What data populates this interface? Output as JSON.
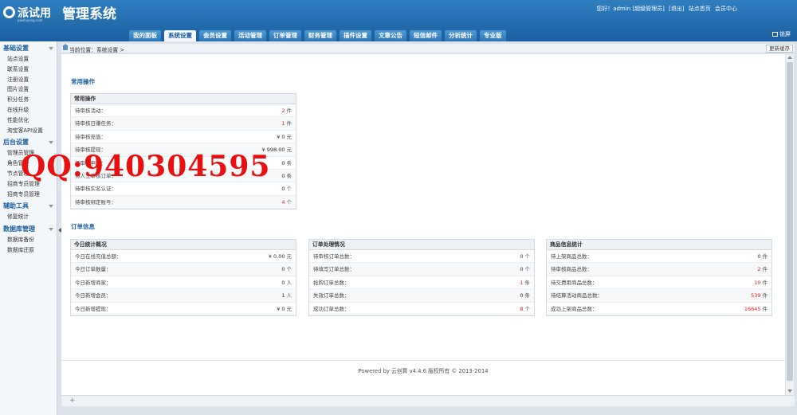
{
  "header": {
    "logo_text": "派试用",
    "logo_sub": "paishiyong.com",
    "title": "管理系统",
    "links": [
      "您好！admin [超级管理员]",
      "[退出]",
      "站点首页",
      "会员中心"
    ],
    "lock_label": "锁屏",
    "nav_tabs": [
      {
        "label": "我的面板",
        "active": false
      },
      {
        "label": "系统设置",
        "active": true
      },
      {
        "label": "会员设置",
        "active": false
      },
      {
        "label": "活动管理",
        "active": false
      },
      {
        "label": "订单管理",
        "active": false
      },
      {
        "label": "财务管理",
        "active": false
      },
      {
        "label": "插件设置",
        "active": false
      },
      {
        "label": "文章公告",
        "active": false
      },
      {
        "label": "短信邮件",
        "active": false
      },
      {
        "label": "分析统计",
        "active": false
      },
      {
        "label": "专业版",
        "active": false
      }
    ]
  },
  "sidebar": {
    "groups": [
      {
        "title": "基础设置",
        "items": [
          "站点设置",
          "联系设置",
          "注册设置",
          "图片设置",
          "积分任务",
          "在线升级",
          "性能优化",
          "淘宝客API设置"
        ]
      },
      {
        "title": "后台设置",
        "items": [
          "管理员管理",
          "角色管理",
          "节点管理",
          "招商专员管理",
          "招商专员管理"
        ]
      },
      {
        "title": "辅助工具",
        "items": [
          "修复统计"
        ]
      },
      {
        "title": "数据库管理",
        "items": [
          "数据库备份",
          "数据库还原"
        ]
      }
    ]
  },
  "breadcrumb": "当前位置：系统设置 >",
  "refresh_label": "更新缓存",
  "common": {
    "section_title": "常用操作",
    "table_title": "常用操作",
    "rows": [
      {
        "label": "待审核活动：",
        "value": "2",
        "unit": "件",
        "red": true
      },
      {
        "label": "待审核日赚任务：",
        "value": "1",
        "unit": "件",
        "red": true
      },
      {
        "label": "待审核充值：",
        "value": "¥ 0",
        "unit": "元",
        "red": false
      },
      {
        "label": "待审核提现：",
        "value": "¥ 998.00",
        "unit": "元",
        "red": false
      },
      {
        "label": "待审核申诉：",
        "value": "0",
        "unit": "条",
        "red": false
      },
      {
        "label": "待人工审核订单：",
        "value": "0",
        "unit": "条",
        "red": false
      },
      {
        "label": "待审核实名认证：",
        "value": "0",
        "unit": "个",
        "red": false
      },
      {
        "label": "待审核绑定账号：",
        "value": "4",
        "unit": "个",
        "red": true
      }
    ]
  },
  "orders": {
    "section_title": "订单信息",
    "today": {
      "title": "今日统计概况",
      "rows": [
        {
          "label": "今日在线充值总额：",
          "value": "¥ 0.00",
          "unit": "元",
          "red": false
        },
        {
          "label": "今日订单数量：",
          "value": "0",
          "unit": "个",
          "red": false
        },
        {
          "label": "今日新增商家：",
          "value": "0",
          "unit": "人",
          "red": false
        },
        {
          "label": "今日新增会员：",
          "value": "1",
          "unit": "人",
          "red": false
        },
        {
          "label": "今日新增提现：",
          "value": "¥ 0",
          "unit": "元",
          "red": false
        }
      ]
    },
    "processing": {
      "title": "订单处理情况",
      "rows": [
        {
          "label": "待审核订单总数：",
          "value": "0",
          "unit": "个",
          "red": false
        },
        {
          "label": "待填写订单总数：",
          "value": "0",
          "unit": "个",
          "red": false
        },
        {
          "label": "抢购订单总数：",
          "value": "1",
          "unit": "条",
          "red": true
        },
        {
          "label": "失效订单总数：",
          "value": "0",
          "unit": "条",
          "red": false
        },
        {
          "label": "成功订单总数：",
          "value": "8",
          "unit": "个",
          "red": true
        }
      ]
    },
    "goods": {
      "title": "商品信息统计",
      "rows": [
        {
          "label": "待上架商品总数：",
          "value": "0",
          "unit": "件",
          "red": false
        },
        {
          "label": "待审核商品总数：",
          "value": "2",
          "unit": "件",
          "red": true
        },
        {
          "label": "待交费用商品总数：",
          "value": "10",
          "unit": "件",
          "red": true
        },
        {
          "label": "待结算活动商品总数：",
          "value": "539",
          "unit": "件",
          "red": true
        },
        {
          "label": "成功上架商品总数：",
          "value": "16645",
          "unit": "件",
          "red": true
        }
      ]
    }
  },
  "footer": "Powered by 云创算 v4.4.6 版权所有 © 2013-2014",
  "watermark": "QQ:940304595"
}
